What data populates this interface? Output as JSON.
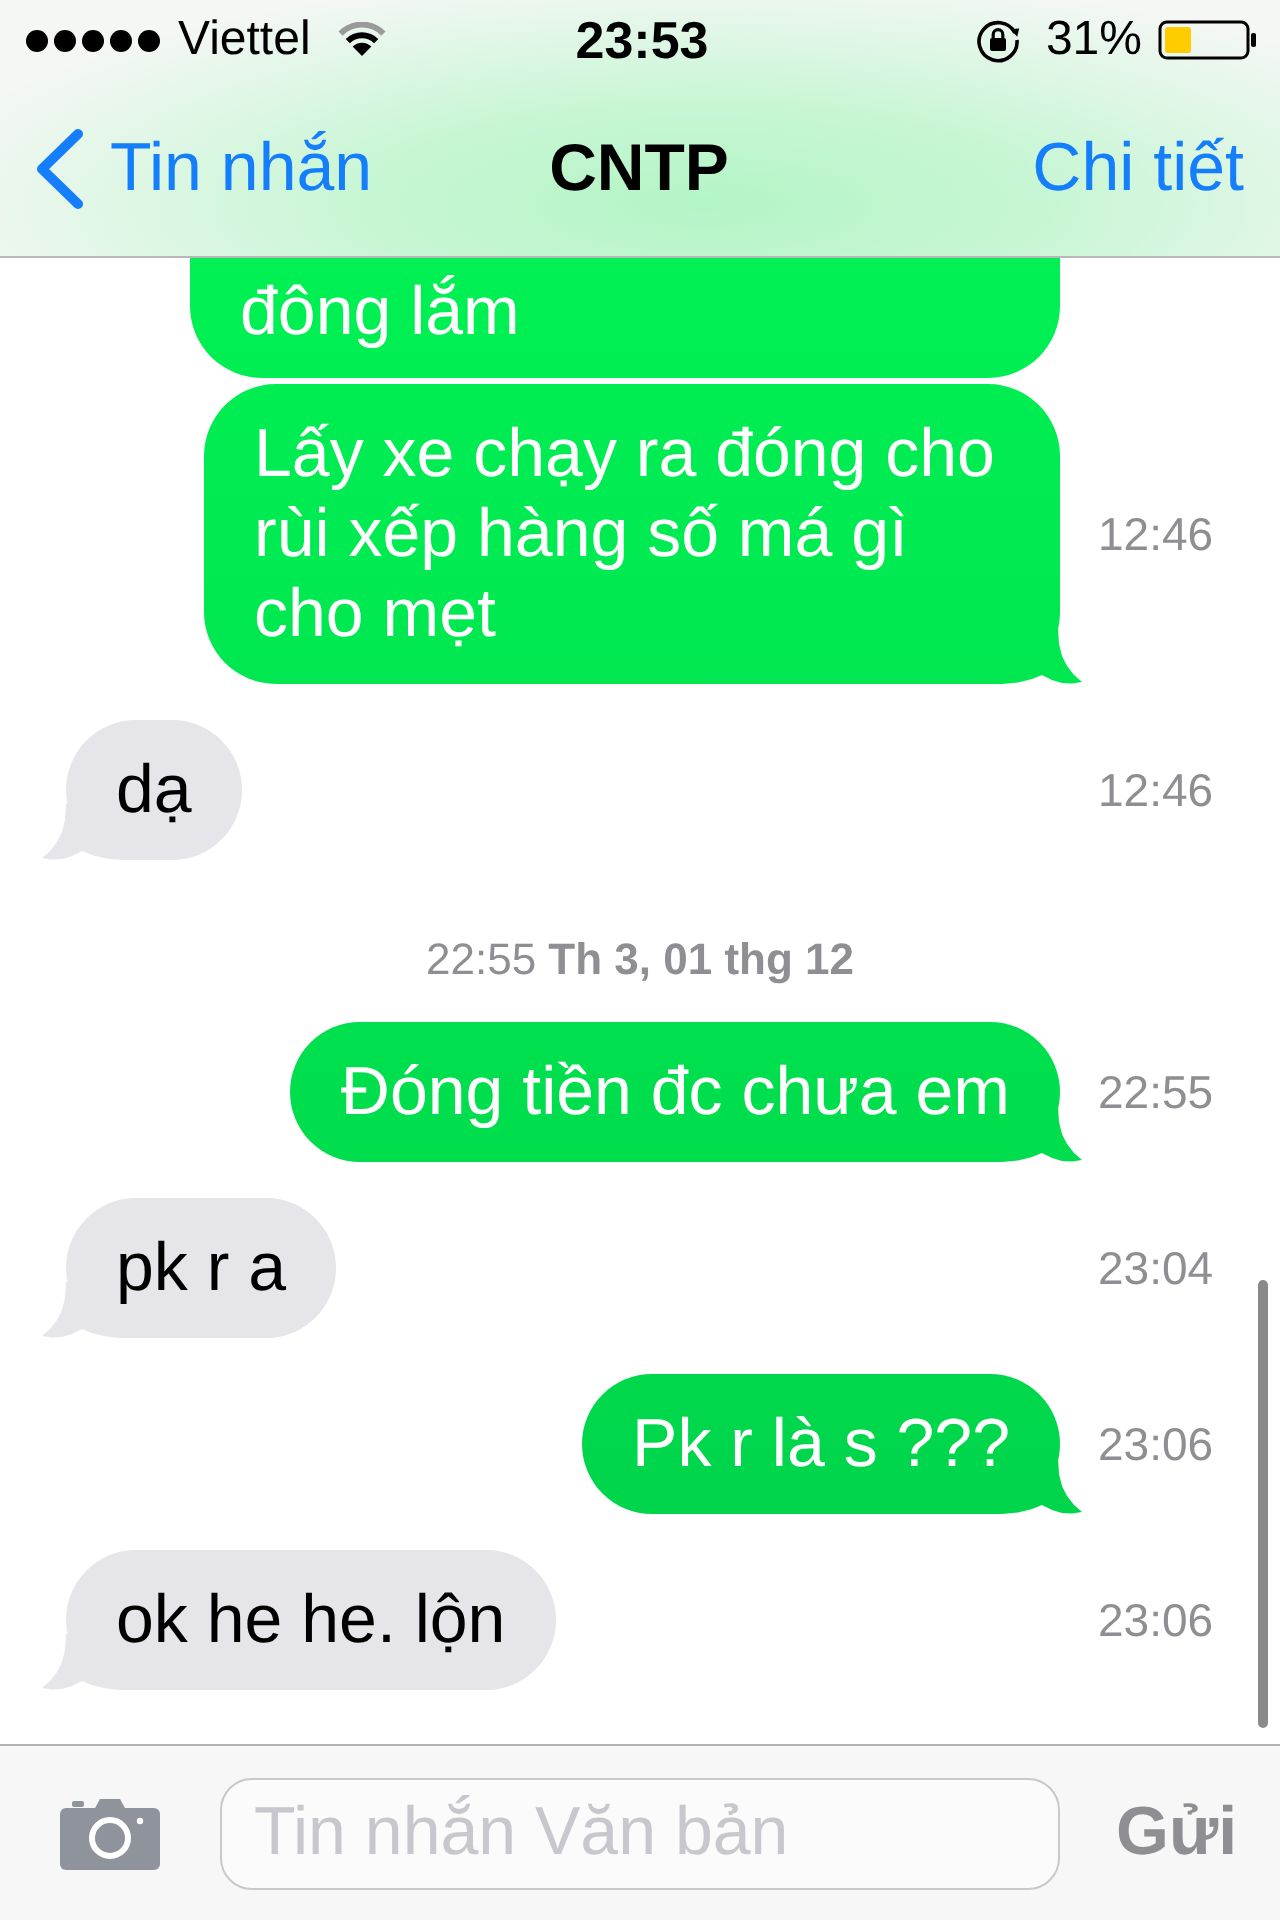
{
  "status_bar": {
    "carrier": "Viettel",
    "time": "23:53",
    "battery": "31%"
  },
  "nav": {
    "back": "Tin nhắn",
    "title": "CNTP",
    "action": "Chi tiết"
  },
  "partial_message": {
    "text": "đông lắm"
  },
  "messages": [
    {
      "kind": "sent",
      "text": "Lấy xe chạy ra đóng cho rùi xếp hàng số má gì cho mẹt",
      "time": "12:46"
    },
    {
      "kind": "received",
      "text": "dạ",
      "time": "12:46"
    },
    {
      "kind": "date",
      "text": "22:55 **Th 3, 01 thg 12**"
    },
    {
      "kind": "sent",
      "text": "Đóng tiền đc chưa em",
      "time": "22:55"
    },
    {
      "kind": "received",
      "text": "pk r a",
      "time": "23:04"
    },
    {
      "kind": "sent",
      "text": "Pk r là s ???",
      "time": "23:06"
    },
    {
      "kind": "received",
      "text": "ok he he. lộn",
      "time": "23:06"
    }
  ],
  "composer": {
    "placeholder": "Tin nhắn Văn bản",
    "send": {
      "label": "Gửi",
      "disabled": true
    }
  }
}
